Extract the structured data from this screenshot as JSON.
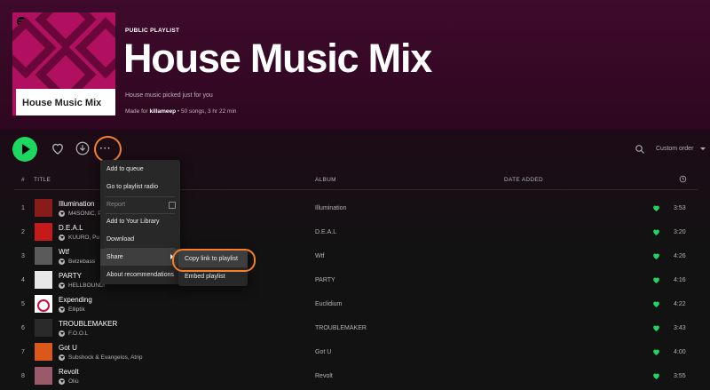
{
  "playlist": {
    "type_label": "PUBLIC PLAYLIST",
    "title": "House Music Mix",
    "cover_title": "House Music Mix",
    "description": "House music picked just for you",
    "made_for_prefix": "Made for",
    "made_for_user": "killameep",
    "stats": "• 50 songs, 3 hr 22 min"
  },
  "controls": {
    "play_icon": "play-icon",
    "like_icon": "heart-outline-icon",
    "download_icon": "download-circle-icon",
    "more_label": "···",
    "search_icon": "search-icon",
    "order_label": "Custom order"
  },
  "table_header": {
    "num": "#",
    "title": "TITLE",
    "album": "ALBUM",
    "date_added": "DATE ADDED",
    "duration_icon": "clock-icon"
  },
  "tracks": [
    {
      "num": "1",
      "title": "Illumination",
      "artist": "M4SONIC, Pa",
      "album": "Illumination",
      "duration": "3:53",
      "thumb_color": "#8a1b1b"
    },
    {
      "num": "2",
      "title": "D.E.A.L",
      "artist": "KUURO, Pu",
      "album": "D.E.A.L",
      "duration": "3:20",
      "thumb_color": "#c41a1a"
    },
    {
      "num": "3",
      "title": "Wtf",
      "artist": "Belzebass",
      "album": "Wtf",
      "duration": "4:26",
      "thumb_color": "#5a5a5a"
    },
    {
      "num": "4",
      "title": "PARTY",
      "artist": "HELLBOUND!",
      "album": "PARTY",
      "duration": "4:16",
      "thumb_color": "#e8e8e8"
    },
    {
      "num": "5",
      "title": "Expending",
      "artist": "Elliptik",
      "album": "Euclidium",
      "duration": "4:22",
      "thumb_color": "#ffffff"
    },
    {
      "num": "6",
      "title": "TROUBLEMAKER",
      "artist": "F.O.O.L",
      "album": "TROUBLEMAKER",
      "duration": "3:43",
      "thumb_color": "#2a2a2a"
    },
    {
      "num": "7",
      "title": "Got U",
      "artist": "Subshock & Evangelos, Atrip",
      "album": "Got U",
      "duration": "4:00",
      "thumb_color": "#d9581a"
    },
    {
      "num": "8",
      "title": "Revolt",
      "artist": "Oliù",
      "album": "Revolt",
      "duration": "3:55",
      "thumb_color": "#9a5a6a"
    }
  ],
  "colors": {
    "accent_green": "#1ed760",
    "highlight_orange": "#f58028",
    "header_bg": "#3f0a2c",
    "cover_pink": "#b0105f"
  },
  "context_menu": {
    "items": [
      {
        "label": "Add to queue"
      },
      {
        "label": "Go to playlist radio"
      },
      {
        "label": "Report"
      },
      {
        "label": "Add to Your Library"
      },
      {
        "label": "Download"
      },
      {
        "label": "Share"
      },
      {
        "label": "About recommendations"
      }
    ],
    "share_submenu": [
      {
        "label": "Copy link to playlist"
      },
      {
        "label": "Embed playlist"
      }
    ]
  }
}
